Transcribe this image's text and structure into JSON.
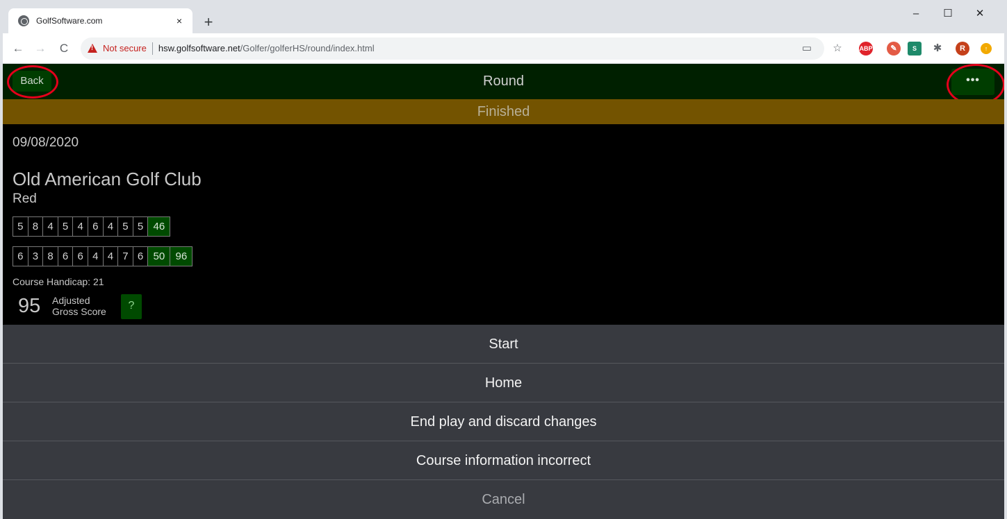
{
  "browser": {
    "tab_title": "GolfSoftware.com",
    "tab_close": "×",
    "new_tab": "+",
    "security_label": "Not secure",
    "url_host": "hsw.golfsoftware.net",
    "url_path": "/Golfer/golferHS/round/index.html",
    "window_controls": {
      "minimize": "–",
      "maximize": "☐",
      "close": "✕"
    },
    "nav": {
      "back": "←",
      "forward": "→",
      "reload": "C"
    },
    "extensions": {
      "abp": "ABP",
      "stylus": "S",
      "avatar": "R",
      "update": "↑"
    }
  },
  "app": {
    "back_label": "Back",
    "title": "Round",
    "more_label": "•••",
    "status": "Finished"
  },
  "round": {
    "date": "09/08/2020",
    "course": "Old American Golf Club",
    "tee": "Red",
    "front_nine": [
      "5",
      "8",
      "4",
      "5",
      "4",
      "6",
      "4",
      "5",
      "5"
    ],
    "front_total": "46",
    "back_nine": [
      "6",
      "3",
      "8",
      "6",
      "6",
      "4",
      "4",
      "7",
      "6"
    ],
    "back_total": "50",
    "total": "96",
    "handicap_text": "Course Handicap: 21",
    "adjusted_score": "95",
    "adjusted_label_line1": "Adjusted",
    "adjusted_label_line2": "Gross Score",
    "help_label": "?"
  },
  "action_sheet": {
    "items": [
      "Start",
      "Home",
      "End play and discard changes",
      "Course information incorrect"
    ],
    "cancel": "Cancel"
  },
  "colors": {
    "header_bg": "#002000",
    "button_bg": "#003d00",
    "status_bg": "#735300",
    "total_cell_bg": "#004a00",
    "sheet_bg": "#383a40",
    "annotation_ring": "#e4001b"
  }
}
